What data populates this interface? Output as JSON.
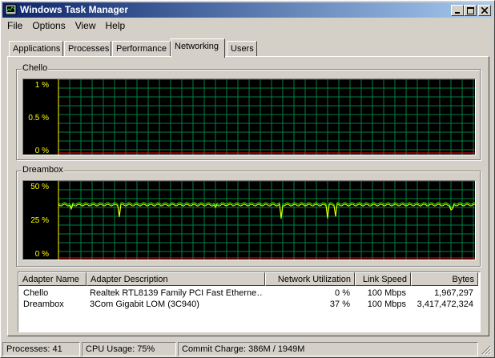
{
  "window": {
    "title": "Windows Task Manager"
  },
  "menu": [
    "File",
    "Options",
    "View",
    "Help"
  ],
  "tabs": [
    "Applications",
    "Processes",
    "Performance",
    "Networking",
    "Users"
  ],
  "active_tab": "Networking",
  "graphs": [
    {
      "name": "Chello",
      "y_labels": [
        "1 %",
        "0.5 %",
        "0 %"
      ]
    },
    {
      "name": "Dreambox",
      "y_labels": [
        "50 %",
        "25 %",
        "0 %"
      ]
    }
  ],
  "table": {
    "headers": [
      "Adapter Name",
      "Adapter Description",
      "Network Utilization",
      "Link Speed",
      "Bytes"
    ],
    "rows": [
      {
        "name": "Chello",
        "description": "Realtek RTL8139 Family PCI Fast Etherne…",
        "utilization": "0 %",
        "speed": "100 Mbps",
        "bytes": "1,967,297"
      },
      {
        "name": "Dreambox",
        "description": "3Com Gigabit LOM (3C940)",
        "utilization": "37 %",
        "speed": "100 Mbps",
        "bytes": "3,417,472,324"
      }
    ]
  },
  "status": {
    "processes": "Processes: 41",
    "cpu": "CPU Usage: 75%",
    "commit": "Commit Charge: 386M / 1949M"
  },
  "colors": {
    "grid": "#008040",
    "trace": "#00ff00",
    "trace_alt": "#ffff00",
    "baseline": "#ff0000",
    "label": "#ffff00",
    "titlebar": "#0a246a"
  }
}
